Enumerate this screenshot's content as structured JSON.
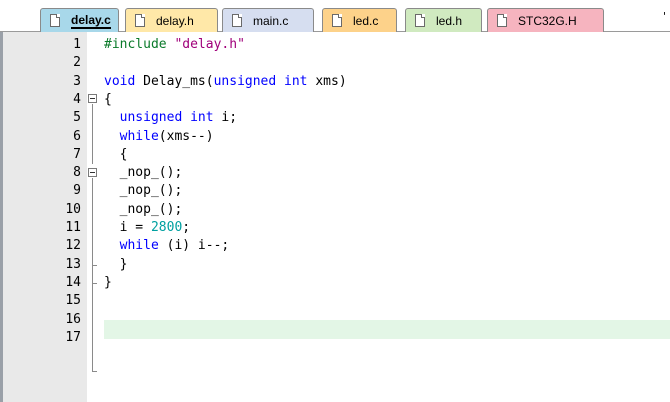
{
  "tabs": [
    {
      "label": "delay.c",
      "color": "#a8d8ea",
      "active": true
    },
    {
      "label": "delay.h",
      "color": "#ffe8a8",
      "active": false
    },
    {
      "label": "main.c",
      "color": "#d6def0",
      "active": false
    },
    {
      "label": "led.c",
      "color": "#fdd28a",
      "active": false
    },
    {
      "label": "led.h",
      "color": "#d0eac0",
      "active": false
    },
    {
      "label": "STC32G.H",
      "color": "#f6b4bf",
      "active": false
    }
  ],
  "tab_overflow_glyph": "'",
  "line_numbers": [
    "1",
    "2",
    "3",
    "4",
    "5",
    "6",
    "7",
    "8",
    "9",
    "10",
    "11",
    "12",
    "13",
    "14",
    "15",
    "16",
    "17"
  ],
  "code": {
    "l1_directive": "#include",
    "l1_string": "\"delay.h\"",
    "l3_type": "void",
    "l3_name": "Delay_ms(",
    "l3_param_type": "unsigned int",
    "l3_param": "xms)",
    "l4_brace": "{",
    "l5_type": "unsigned int",
    "l5_rest": "i;",
    "l6_kw": "while",
    "l6_rest": "(xms--)",
    "l7_brace": "{",
    "l8": "_nop_();",
    "l9": "_nop_();",
    "l10": "_nop_();",
    "l11_lhs": "i =",
    "l11_num": "2800",
    "l11_semi": ";",
    "l12_kw": "while",
    "l12_rest": "(i) i--;",
    "l13_brace": "}",
    "l14_brace": "}"
  },
  "colors": {
    "keyword": "#0000ff",
    "string": "#a0007a",
    "preprocessor": "#0a7a2a",
    "number": "#00a0a0",
    "current_line": "#e3f6e6",
    "gutter": "#e9e9e9"
  }
}
